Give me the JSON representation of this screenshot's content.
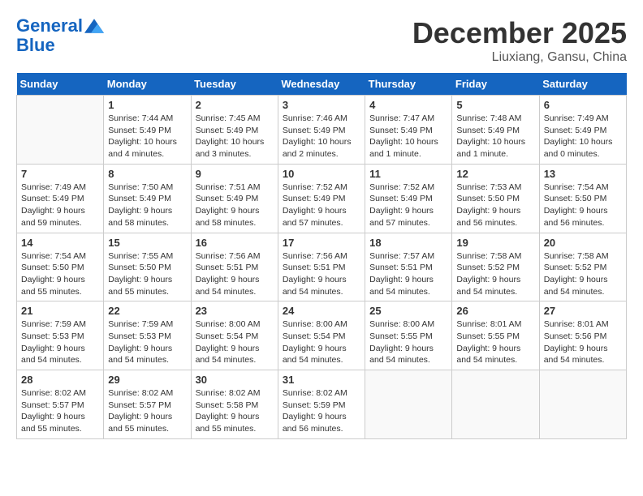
{
  "header": {
    "logo_line1": "General",
    "logo_line2": "Blue",
    "month": "December 2025",
    "location": "Liuxiang, Gansu, China"
  },
  "days_of_week": [
    "Sunday",
    "Monday",
    "Tuesday",
    "Wednesday",
    "Thursday",
    "Friday",
    "Saturday"
  ],
  "weeks": [
    [
      {
        "day": "",
        "sunrise": "",
        "sunset": "",
        "daylight": "",
        "empty": true
      },
      {
        "day": "1",
        "sunrise": "Sunrise: 7:44 AM",
        "sunset": "Sunset: 5:49 PM",
        "daylight": "Daylight: 10 hours and 4 minutes."
      },
      {
        "day": "2",
        "sunrise": "Sunrise: 7:45 AM",
        "sunset": "Sunset: 5:49 PM",
        "daylight": "Daylight: 10 hours and 3 minutes."
      },
      {
        "day": "3",
        "sunrise": "Sunrise: 7:46 AM",
        "sunset": "Sunset: 5:49 PM",
        "daylight": "Daylight: 10 hours and 2 minutes."
      },
      {
        "day": "4",
        "sunrise": "Sunrise: 7:47 AM",
        "sunset": "Sunset: 5:49 PM",
        "daylight": "Daylight: 10 hours and 1 minute."
      },
      {
        "day": "5",
        "sunrise": "Sunrise: 7:48 AM",
        "sunset": "Sunset: 5:49 PM",
        "daylight": "Daylight: 10 hours and 1 minute."
      },
      {
        "day": "6",
        "sunrise": "Sunrise: 7:49 AM",
        "sunset": "Sunset: 5:49 PM",
        "daylight": "Daylight: 10 hours and 0 minutes."
      }
    ],
    [
      {
        "day": "7",
        "sunrise": "Sunrise: 7:49 AM",
        "sunset": "Sunset: 5:49 PM",
        "daylight": "Daylight: 9 hours and 59 minutes."
      },
      {
        "day": "8",
        "sunrise": "Sunrise: 7:50 AM",
        "sunset": "Sunset: 5:49 PM",
        "daylight": "Daylight: 9 hours and 58 minutes."
      },
      {
        "day": "9",
        "sunrise": "Sunrise: 7:51 AM",
        "sunset": "Sunset: 5:49 PM",
        "daylight": "Daylight: 9 hours and 58 minutes."
      },
      {
        "day": "10",
        "sunrise": "Sunrise: 7:52 AM",
        "sunset": "Sunset: 5:49 PM",
        "daylight": "Daylight: 9 hours and 57 minutes."
      },
      {
        "day": "11",
        "sunrise": "Sunrise: 7:52 AM",
        "sunset": "Sunset: 5:49 PM",
        "daylight": "Daylight: 9 hours and 57 minutes."
      },
      {
        "day": "12",
        "sunrise": "Sunrise: 7:53 AM",
        "sunset": "Sunset: 5:50 PM",
        "daylight": "Daylight: 9 hours and 56 minutes."
      },
      {
        "day": "13",
        "sunrise": "Sunrise: 7:54 AM",
        "sunset": "Sunset: 5:50 PM",
        "daylight": "Daylight: 9 hours and 56 minutes."
      }
    ],
    [
      {
        "day": "14",
        "sunrise": "Sunrise: 7:54 AM",
        "sunset": "Sunset: 5:50 PM",
        "daylight": "Daylight: 9 hours and 55 minutes."
      },
      {
        "day": "15",
        "sunrise": "Sunrise: 7:55 AM",
        "sunset": "Sunset: 5:50 PM",
        "daylight": "Daylight: 9 hours and 55 minutes."
      },
      {
        "day": "16",
        "sunrise": "Sunrise: 7:56 AM",
        "sunset": "Sunset: 5:51 PM",
        "daylight": "Daylight: 9 hours and 54 minutes."
      },
      {
        "day": "17",
        "sunrise": "Sunrise: 7:56 AM",
        "sunset": "Sunset: 5:51 PM",
        "daylight": "Daylight: 9 hours and 54 minutes."
      },
      {
        "day": "18",
        "sunrise": "Sunrise: 7:57 AM",
        "sunset": "Sunset: 5:51 PM",
        "daylight": "Daylight: 9 hours and 54 minutes."
      },
      {
        "day": "19",
        "sunrise": "Sunrise: 7:58 AM",
        "sunset": "Sunset: 5:52 PM",
        "daylight": "Daylight: 9 hours and 54 minutes."
      },
      {
        "day": "20",
        "sunrise": "Sunrise: 7:58 AM",
        "sunset": "Sunset: 5:52 PM",
        "daylight": "Daylight: 9 hours and 54 minutes."
      }
    ],
    [
      {
        "day": "21",
        "sunrise": "Sunrise: 7:59 AM",
        "sunset": "Sunset: 5:53 PM",
        "daylight": "Daylight: 9 hours and 54 minutes."
      },
      {
        "day": "22",
        "sunrise": "Sunrise: 7:59 AM",
        "sunset": "Sunset: 5:53 PM",
        "daylight": "Daylight: 9 hours and 54 minutes."
      },
      {
        "day": "23",
        "sunrise": "Sunrise: 8:00 AM",
        "sunset": "Sunset: 5:54 PM",
        "daylight": "Daylight: 9 hours and 54 minutes."
      },
      {
        "day": "24",
        "sunrise": "Sunrise: 8:00 AM",
        "sunset": "Sunset: 5:54 PM",
        "daylight": "Daylight: 9 hours and 54 minutes."
      },
      {
        "day": "25",
        "sunrise": "Sunrise: 8:00 AM",
        "sunset": "Sunset: 5:55 PM",
        "daylight": "Daylight: 9 hours and 54 minutes."
      },
      {
        "day": "26",
        "sunrise": "Sunrise: 8:01 AM",
        "sunset": "Sunset: 5:55 PM",
        "daylight": "Daylight: 9 hours and 54 minutes."
      },
      {
        "day": "27",
        "sunrise": "Sunrise: 8:01 AM",
        "sunset": "Sunset: 5:56 PM",
        "daylight": "Daylight: 9 hours and 54 minutes."
      }
    ],
    [
      {
        "day": "28",
        "sunrise": "Sunrise: 8:02 AM",
        "sunset": "Sunset: 5:57 PM",
        "daylight": "Daylight: 9 hours and 55 minutes."
      },
      {
        "day": "29",
        "sunrise": "Sunrise: 8:02 AM",
        "sunset": "Sunset: 5:57 PM",
        "daylight": "Daylight: 9 hours and 55 minutes."
      },
      {
        "day": "30",
        "sunrise": "Sunrise: 8:02 AM",
        "sunset": "Sunset: 5:58 PM",
        "daylight": "Daylight: 9 hours and 55 minutes."
      },
      {
        "day": "31",
        "sunrise": "Sunrise: 8:02 AM",
        "sunset": "Sunset: 5:59 PM",
        "daylight": "Daylight: 9 hours and 56 minutes."
      },
      {
        "day": "",
        "sunrise": "",
        "sunset": "",
        "daylight": "",
        "empty": true
      },
      {
        "day": "",
        "sunrise": "",
        "sunset": "",
        "daylight": "",
        "empty": true
      },
      {
        "day": "",
        "sunrise": "",
        "sunset": "",
        "daylight": "",
        "empty": true
      }
    ]
  ]
}
